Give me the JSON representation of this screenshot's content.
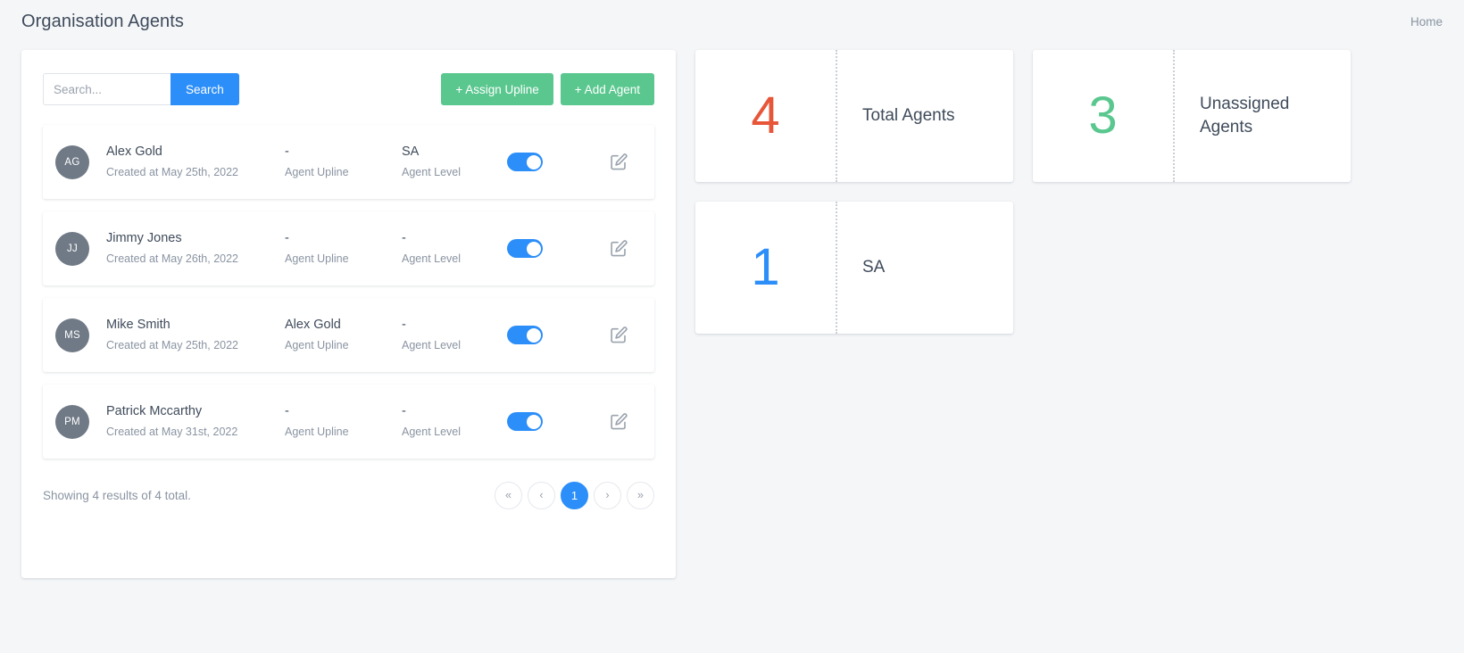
{
  "header": {
    "title": "Organisation Agents",
    "breadcrumb": "Home"
  },
  "toolbar": {
    "search_placeholder": "Search...",
    "search_value": "",
    "search_button": "Search",
    "assign_upline_button": "+ Assign Upline",
    "add_agent_button": "+ Add Agent"
  },
  "columns": {
    "upline_label": "Agent Upline",
    "level_label": "Agent Level"
  },
  "agents": [
    {
      "initials": "AG",
      "name": "Alex Gold",
      "created": "Created at May 25th, 2022",
      "upline": "-",
      "upline_label": "Agent Upline",
      "level": "SA",
      "level_label": "Agent Level",
      "active": true
    },
    {
      "initials": "JJ",
      "name": "Jimmy Jones",
      "created": "Created at May 26th, 2022",
      "upline": "-",
      "upline_label": "Agent Upline",
      "level": "-",
      "level_label": "Agent Level",
      "active": true
    },
    {
      "initials": "MS",
      "name": "Mike Smith",
      "created": "Created at May 25th, 2022",
      "upline": "Alex Gold",
      "upline_label": "Agent Upline",
      "level": "-",
      "level_label": "Agent Level",
      "active": true
    },
    {
      "initials": "PM",
      "name": "Patrick Mccarthy",
      "created": "Created at May 31st, 2022",
      "upline": "-",
      "upline_label": "Agent Upline",
      "level": "-",
      "level_label": "Agent Level",
      "active": true
    }
  ],
  "footer": {
    "results_text": "Showing 4 results of 4 total.",
    "pagination": [
      {
        "label": "«",
        "name": "pagination-first",
        "active": false
      },
      {
        "label": "‹",
        "name": "pagination-prev",
        "active": false
      },
      {
        "label": "1",
        "name": "pagination-page-1",
        "active": true
      },
      {
        "label": "›",
        "name": "pagination-next",
        "active": false
      },
      {
        "label": "»",
        "name": "pagination-last",
        "active": false
      }
    ]
  },
  "stats": [
    {
      "value": "4",
      "label": "Total Agents",
      "color": "#e8563a"
    },
    {
      "value": "3",
      "label": "Unassigned Agents",
      "color": "#5ac78f"
    },
    {
      "value": "1",
      "label": "SA",
      "color": "#2c8ef8"
    }
  ],
  "colors": {
    "accent_blue": "#2c8ef8",
    "accent_green": "#5ac78f",
    "accent_orange": "#e8563a",
    "text_dark": "#3f4b5b",
    "text_muted": "#8a94a2",
    "page_bg": "#f4f6f8"
  }
}
